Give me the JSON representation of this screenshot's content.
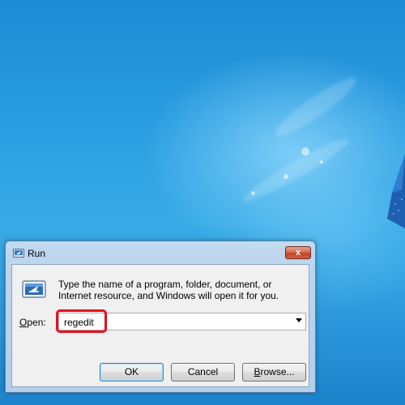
{
  "window": {
    "title": "Run",
    "close_glyph": "x",
    "description": "Type the name of a program, folder, document, or Internet resource, and Windows will open it for you.",
    "title_icon": "run-icon",
    "body_icon": "run-icon"
  },
  "open_field": {
    "label_accel": "O",
    "label_rest": "pen:",
    "value": "regedit"
  },
  "buttons": {
    "ok": "OK",
    "cancel": "Cancel",
    "browse_accel": "B",
    "browse_rest": "rowse..."
  },
  "colors": {
    "highlight": "#e81018",
    "desktop_blue": "#2a9de0"
  }
}
